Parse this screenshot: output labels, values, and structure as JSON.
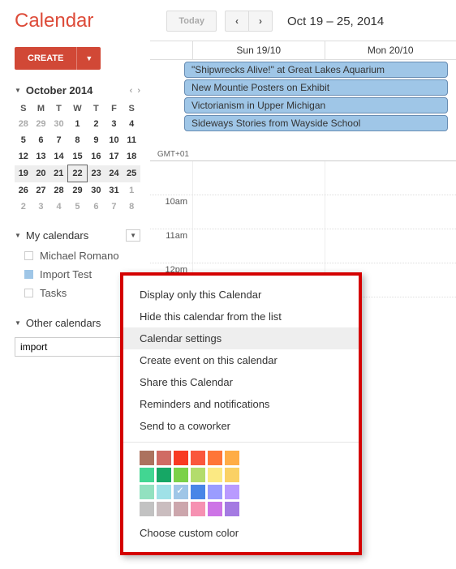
{
  "header": {
    "logo": "Calendar",
    "today": "Today",
    "date_range": "Oct 19 – 25, 2014"
  },
  "sidebar": {
    "create": "CREATE",
    "mini_cal": {
      "month": "October 2014",
      "dow": [
        "S",
        "M",
        "T",
        "W",
        "T",
        "F",
        "S"
      ],
      "weeks": [
        [
          {
            "d": "28",
            "dim": true
          },
          {
            "d": "29",
            "dim": true
          },
          {
            "d": "30",
            "dim": true
          },
          {
            "d": "1"
          },
          {
            "d": "2"
          },
          {
            "d": "3"
          },
          {
            "d": "4"
          }
        ],
        [
          {
            "d": "5"
          },
          {
            "d": "6"
          },
          {
            "d": "7"
          },
          {
            "d": "8"
          },
          {
            "d": "9"
          },
          {
            "d": "10"
          },
          {
            "d": "11"
          }
        ],
        [
          {
            "d": "12"
          },
          {
            "d": "13"
          },
          {
            "d": "14"
          },
          {
            "d": "15"
          },
          {
            "d": "16"
          },
          {
            "d": "17"
          },
          {
            "d": "18"
          }
        ],
        [
          {
            "d": "19"
          },
          {
            "d": "20"
          },
          {
            "d": "21"
          },
          {
            "d": "22",
            "today": true
          },
          {
            "d": "23"
          },
          {
            "d": "24"
          },
          {
            "d": "25"
          }
        ],
        [
          {
            "d": "26"
          },
          {
            "d": "27"
          },
          {
            "d": "28"
          },
          {
            "d": "29"
          },
          {
            "d": "30"
          },
          {
            "d": "31"
          },
          {
            "d": "1",
            "dim": true
          }
        ],
        [
          {
            "d": "2",
            "dim": true
          },
          {
            "d": "3",
            "dim": true
          },
          {
            "d": "4",
            "dim": true
          },
          {
            "d": "5",
            "dim": true
          },
          {
            "d": "6",
            "dim": true
          },
          {
            "d": "7",
            "dim": true
          },
          {
            "d": "8",
            "dim": true
          }
        ]
      ]
    },
    "my_calendars": {
      "title": "My calendars",
      "items": [
        {
          "label": "Michael Romano",
          "on": false
        },
        {
          "label": "Import Test",
          "on": true
        },
        {
          "label": "Tasks",
          "on": false
        }
      ]
    },
    "other_calendars": {
      "title": "Other calendars",
      "search_value": "import"
    }
  },
  "grid": {
    "tz": "GMT+01",
    "days": [
      "Sun 19/10",
      "Mon 20/10"
    ],
    "allday_events": [
      "\"Shipwrecks Alive!\" at Great Lakes Aquarium",
      "New Mountie Posters on Exhibit",
      "Victorianism in Upper Michigan",
      "Sideways Stories from Wayside School"
    ],
    "hours": [
      "",
      "10am",
      "11am",
      "12pm"
    ]
  },
  "context_menu": {
    "items": [
      "Display only this Calendar",
      "Hide this calendar from the list",
      "Calendar settings",
      "Create event on this calendar",
      "Share this Calendar",
      "Reminders and notifications",
      "Send to a coworker"
    ],
    "colors": [
      [
        "#ac725e",
        "#d06b64",
        "#f83a22",
        "#fa573c",
        "#ff7537",
        "#ffad46"
      ],
      [
        "#42d692",
        "#16a765",
        "#7bd148",
        "#b3dc6c",
        "#fbe983",
        "#fad165"
      ],
      [
        "#92e1c0",
        "#9fe1e7",
        "#9fc6e7",
        "#4986e7",
        "#9a9cff",
        "#b99aff"
      ],
      [
        "#c2c2c2",
        "#cabdbf",
        "#cca6ac",
        "#f691b2",
        "#cd74e6",
        "#a47ae2"
      ]
    ],
    "selected_color": "#9fc6e7",
    "custom": "Choose custom color"
  }
}
